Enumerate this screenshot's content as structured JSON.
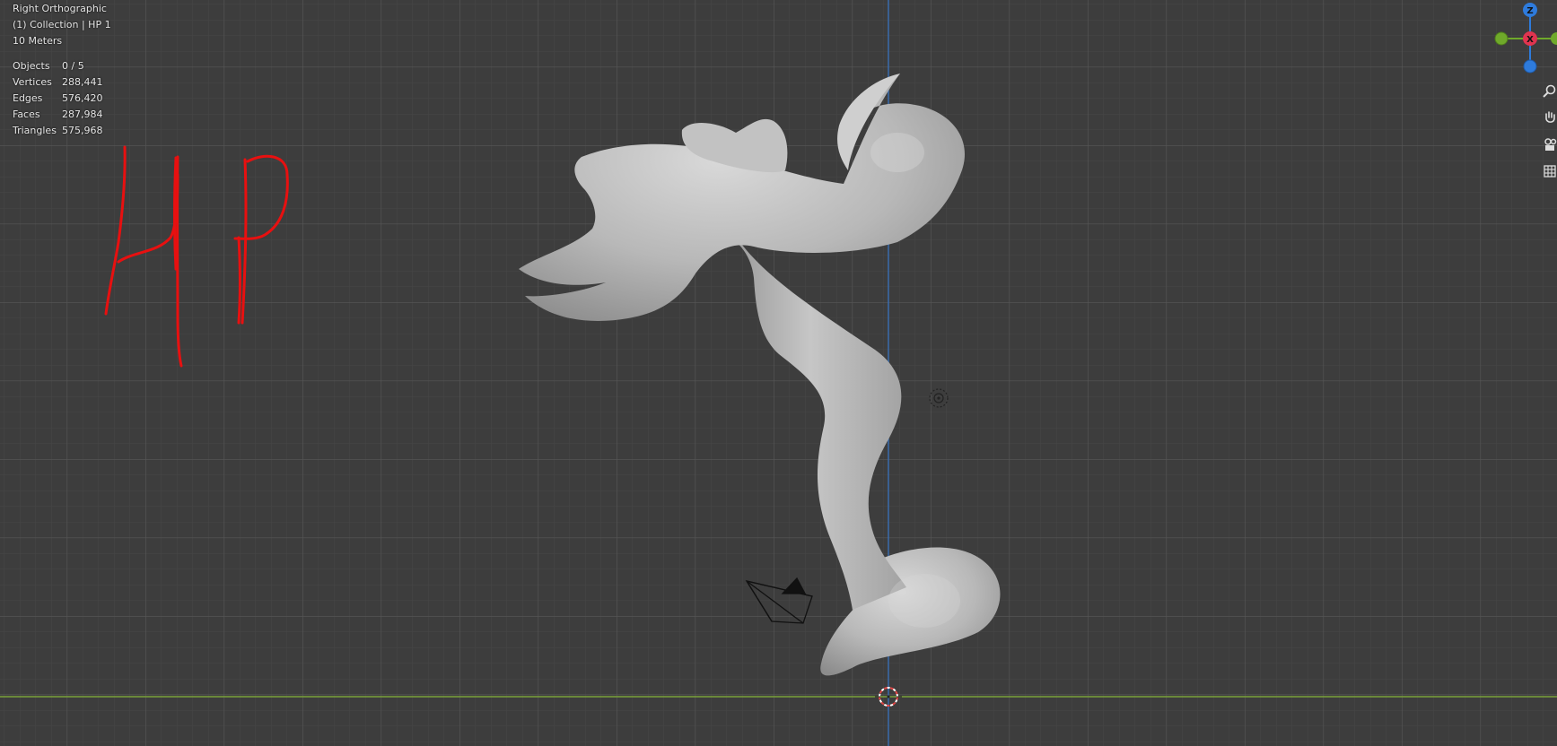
{
  "viewport": {
    "view_name": "Right Orthographic",
    "collection": "(1) Collection | HP 1",
    "grid_scale": "10 Meters",
    "stats": [
      {
        "label": "Objects",
        "value": "0 / 5"
      },
      {
        "label": "Vertices",
        "value": "288,441"
      },
      {
        "label": "Edges",
        "value": "576,420"
      },
      {
        "label": "Faces",
        "value": "287,984"
      },
      {
        "label": "Triangles",
        "value": "575,968"
      }
    ]
  },
  "gizmo": {
    "z_label": "Z",
    "x_label": "X",
    "z_color": "#2e7bdc",
    "x_color": "#e0344f",
    "y_color": "#6fa92a"
  },
  "nav_tools": [
    "zoom-icon",
    "hand-pan-icon",
    "camera-view-icon",
    "grid-view-icon"
  ],
  "annotation": {
    "text": "HP",
    "color": "#e81010"
  },
  "colors": {
    "background": "#3d3d3d",
    "grid_major": "#565656",
    "grid_minor": "#474747",
    "z_axis": "#3a6fb5",
    "y_axis": "#7aa23a",
    "mesh": "#b9b9b9"
  }
}
